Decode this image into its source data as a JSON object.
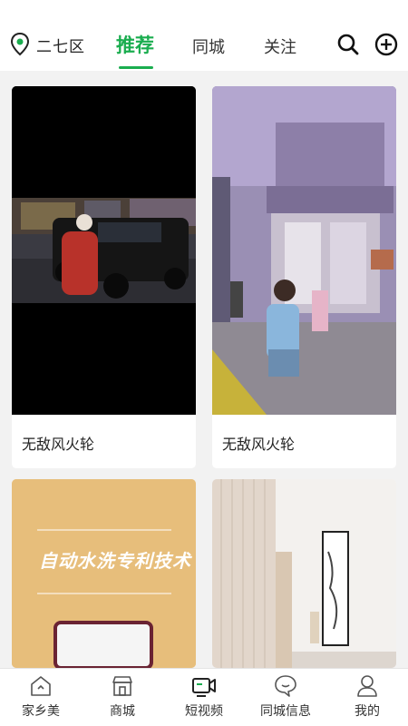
{
  "header": {
    "location": "二七区",
    "tabs": [
      {
        "label": "推荐",
        "active": true
      },
      {
        "label": "同城",
        "active": false
      },
      {
        "label": "关注",
        "active": false
      }
    ],
    "accent_color": "#1aad4f"
  },
  "feed": [
    {
      "title": "无敌风火轮"
    },
    {
      "title": "无敌风火轮"
    },
    {
      "overlay_text": "自动水洗专利技术"
    },
    {}
  ],
  "bottom_nav": [
    {
      "label": "家乡美",
      "icon": "home-icon"
    },
    {
      "label": "商城",
      "icon": "shop-icon"
    },
    {
      "label": "短视频",
      "icon": "video-camera-icon",
      "active": true
    },
    {
      "label": "同城信息",
      "icon": "chat-bubble-icon"
    },
    {
      "label": "我的",
      "icon": "person-icon"
    }
  ]
}
